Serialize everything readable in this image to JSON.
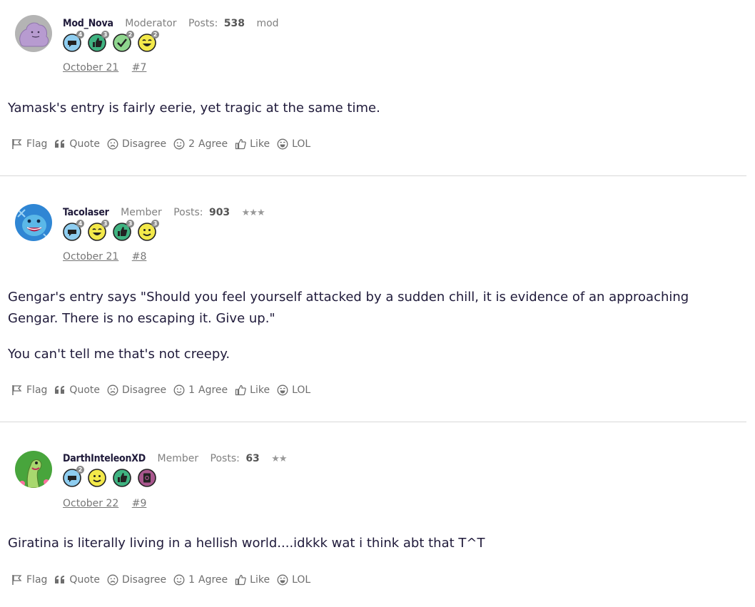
{
  "posts": [
    {
      "username": "Mod_Nova",
      "role": "Moderator",
      "posts_label": "Posts:",
      "posts_count": "538",
      "extra_tag": "mod",
      "badge_counts": [
        "4",
        "3",
        "2",
        "2"
      ],
      "date": "October 21",
      "number": "#7",
      "paragraphs": [
        "Yamask's entry is fairly eerie, yet tragic at the same time."
      ],
      "agree_count": "2"
    },
    {
      "username": "Tacolaser",
      "role": "Member",
      "posts_label": "Posts:",
      "posts_count": "903",
      "rank_stars": "★★★",
      "badge_counts": [
        "4",
        "3",
        "3",
        "3"
      ],
      "date": "October 21",
      "number": "#8",
      "paragraphs": [
        "Gengar's entry says \"Should you feel yourself attacked by a sudden chill, it is evidence of an approaching Gengar.  There is no escaping it. Give up.\"",
        "You can't tell me that's not creepy."
      ],
      "agree_count": "1"
    },
    {
      "username": "DarthInteleonXD",
      "role": "Member",
      "posts_label": "Posts:",
      "posts_count": "63",
      "rank_stars": "★★",
      "badge_counts": [
        "2"
      ],
      "date": "October 22",
      "number": "#9",
      "paragraphs": [
        "Giratina is literally living in a hellish world....idkkk wat i think abt that T^T"
      ],
      "agree_count": "1"
    }
  ],
  "actions": {
    "flag": "Flag",
    "quote": "Quote",
    "disagree": "Disagree",
    "agree": "Agree",
    "like": "Like",
    "lol": "LOL"
  },
  "colors": {
    "text": "#1f1a3a",
    "muted": "#808080",
    "divider": "#d8d8d8",
    "badge_blue": "#8ecdf0",
    "badge_green": "#3fb381",
    "badge_yellow": "#f3e94a",
    "badge_purple": "#a9578e"
  },
  "icons": [
    "flag-icon",
    "quote-icon",
    "disagree-icon",
    "agree-icon",
    "like-icon",
    "lol-icon"
  ]
}
